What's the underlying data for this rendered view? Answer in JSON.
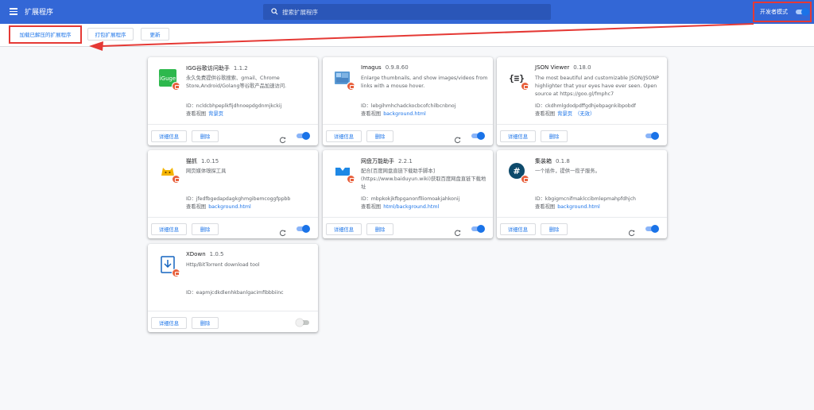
{
  "header": {
    "title": "扩展程序",
    "search_placeholder": "搜索扩展程序",
    "dev_mode_label": "开发者模式",
    "dev_mode_on": true
  },
  "toolbar": {
    "load_unpacked": "加载已解压的扩展程序",
    "pack": "打包扩展程序",
    "update": "更新"
  },
  "labels": {
    "details": "详细信息",
    "remove": "删除",
    "id_prefix": "ID：",
    "views_prefix": "查看视图"
  },
  "extensions": [
    {
      "name": "IGG谷歌访问助手",
      "version": "1.1.2",
      "desc": "永久免费提供谷歌搜索、gmail、Chrome Store,Android/Golang等谷歌产品加速访问.",
      "id": "ncldcbhpeplkfijdhnoepdgdnmjkckij",
      "view": "背景页",
      "view2": "",
      "enabled": true,
      "reload": true,
      "icon": "igg-icon"
    },
    {
      "name": "Imagus",
      "version": "0.9.8.60",
      "desc": "Enlarge thumbnails, and show images/videos from links with a mouse hover.",
      "id": "lebgihmhchadckocbcofchilbcnbnoj",
      "view": "background.html",
      "view2": "",
      "enabled": true,
      "reload": true,
      "icon": "imagus-icon"
    },
    {
      "name": "JSON Viewer",
      "version": "0.18.0",
      "desc": "The most beautiful and customizable JSON/JSONP highlighter that your eyes have ever seen. Open source at https://goo.gl/fmphc7",
      "id": "ckdhmlgdodpdffgdhjebpagnkibpobdf",
      "view": "背景页",
      "view2": "（无效）",
      "enabled": true,
      "reload": false,
      "icon": "json-viewer-icon"
    },
    {
      "name": "猫抓",
      "version": "1.0.15",
      "desc": "网页媒体嗅探工具",
      "id": "jfedfbgedapdagkghmgibemcoggfppbb",
      "view": "background.html",
      "view2": "",
      "enabled": true,
      "reload": true,
      "icon": "cat-catch-icon"
    },
    {
      "name": "网盘万能助手",
      "version": "2.2.1",
      "desc": "配合[百度网盘直链下载助手脚本](https://www.baiduyun.wiki)获取百度网盘直链下载地址",
      "id": "mbpkokjkfbpganonflliomoakjahkonij",
      "view": "html/background.html",
      "view2": "",
      "enabled": true,
      "reload": true,
      "icon": "cloud-helper-icon"
    },
    {
      "name": "集装箱",
      "version": "0.1.8",
      "desc": "一个插件，提供一揽子服务。",
      "id": "kbgigmcnifmaklccibmlepmahpfdhjch",
      "view": "background.html",
      "view2": "",
      "enabled": true,
      "reload": true,
      "icon": "container-icon"
    },
    {
      "name": "XDown",
      "version": "1.0.5",
      "desc": "Http/BitTorrent download tool",
      "id": "eapmjcdkdlenhkbanlgacimfibbbiinc",
      "view": "",
      "view2": "",
      "enabled": false,
      "reload": false,
      "icon": "xdown-icon"
    }
  ],
  "colors": {
    "header_bg": "#3367d6",
    "accent": "#1a73e8",
    "annotation_red": "#e53935"
  }
}
